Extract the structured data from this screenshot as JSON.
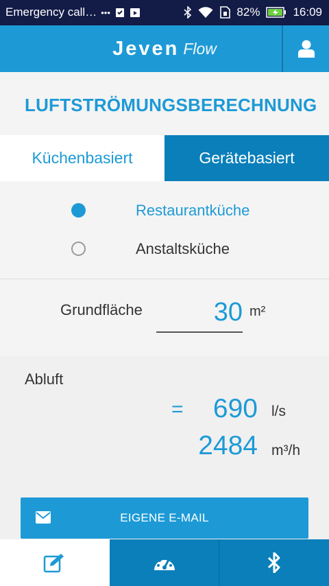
{
  "status_bar": {
    "notification_text": "Emergency call…",
    "more_dots": "•••",
    "battery_percent": "82%",
    "time": "16:09"
  },
  "app_bar": {
    "brand": "Jeven",
    "subtitle": "Flow"
  },
  "page": {
    "title": "LUFTSTRÖMUNGSBERECHNUNG"
  },
  "tabs": [
    {
      "label": "Küchenbasiert",
      "active": false
    },
    {
      "label": "Gerätebasiert",
      "active": true
    }
  ],
  "kitchen_type": {
    "options": [
      {
        "label": "Restaurantküche",
        "selected": true
      },
      {
        "label": "Anstaltsküche",
        "selected": false
      }
    ]
  },
  "area": {
    "label": "Grundfläche",
    "value": "30",
    "unit": "m²"
  },
  "results": {
    "label": "Abluft",
    "equals": "=",
    "flow_ls": "690",
    "flow_ls_unit": "l/s",
    "flow_m3h": "2484",
    "flow_m3h_unit": "m³/h"
  },
  "email_button": {
    "label": "EIGENE E-MAIL"
  },
  "bottom_nav": [
    {
      "icon": "edit-icon",
      "active": true
    },
    {
      "icon": "speedometer-icon",
      "active": false
    },
    {
      "icon": "bluetooth-icon",
      "active": false
    }
  ],
  "colors": {
    "accent": "#1d9ad6",
    "accent_dark": "#0a7fba",
    "status_bar": "#131b47"
  }
}
